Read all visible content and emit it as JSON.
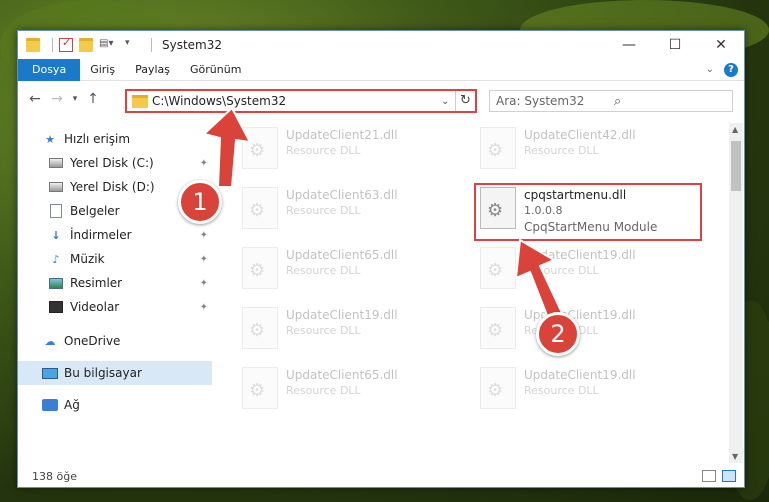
{
  "window": {
    "title": "System32"
  },
  "ribbon": {
    "tabs": [
      {
        "label": "Dosya",
        "active": true
      },
      {
        "label": "Giriş"
      },
      {
        "label": "Paylaş"
      },
      {
        "label": "Görünüm"
      }
    ]
  },
  "address": {
    "path": "C:\\Windows\\System32"
  },
  "search": {
    "placeholder": "Ara: System32"
  },
  "sidebar": {
    "items": [
      {
        "label": "Hızlı erişim",
        "icon": "star-icon",
        "pinned": false
      },
      {
        "label": "Yerel Disk (C:)",
        "icon": "disk-icon",
        "pinned": true
      },
      {
        "label": "Yerel Disk (D:)",
        "icon": "disk-icon",
        "pinned": false
      },
      {
        "label": "Belgeler",
        "icon": "document-icon",
        "pinned": true
      },
      {
        "label": "İndirmeler",
        "icon": "download-icon",
        "pinned": true
      },
      {
        "label": "Müzik",
        "icon": "music-icon",
        "pinned": true
      },
      {
        "label": "Resimler",
        "icon": "pictures-icon",
        "pinned": true
      },
      {
        "label": "Videolar",
        "icon": "video-icon",
        "pinned": true
      },
      {
        "label": "OneDrive",
        "icon": "cloud-icon",
        "pinned": false
      },
      {
        "label": "Bu bilgisayar",
        "icon": "computer-icon",
        "pinned": false,
        "selected": true
      },
      {
        "label": "Ağ",
        "icon": "network-icon",
        "pinned": false
      }
    ]
  },
  "files": [
    {
      "name": "UpdateClient21.dll",
      "type": "Resource DLL",
      "faded": true
    },
    {
      "name": "UpdateClient42.dll",
      "type": "Resource DLL",
      "faded": true
    },
    {
      "name": "UpdateClient63.dll",
      "type": "Resource DLL",
      "faded": true
    },
    {
      "name": "cpqstartmenu.dll",
      "version": "1.0.0.8",
      "type": "CpqStartMenu Module",
      "faded": false
    },
    {
      "name": "UpdateClient65.dll",
      "type": "Resource DLL",
      "faded": true
    },
    {
      "name": "UpdateClient19.dll",
      "type": "Resource DLL",
      "faded": true
    },
    {
      "name": "UpdateClient19.dll",
      "type": "Resource DLL",
      "faded": true
    },
    {
      "name": "UpdateClient19.dll",
      "type": "Resource DLL",
      "faded": true
    },
    {
      "name": "UpdateClient65.dll",
      "type": "Resource DLL",
      "faded": true
    },
    {
      "name": "UpdateClient19.dll",
      "type": "Resource DLL",
      "faded": true
    }
  ],
  "status": {
    "count": "138 öğe"
  },
  "callouts": [
    "1",
    "2"
  ],
  "colors": {
    "accent": "#1979ca",
    "highlight": "#e04040",
    "callout": "#d9433a"
  }
}
